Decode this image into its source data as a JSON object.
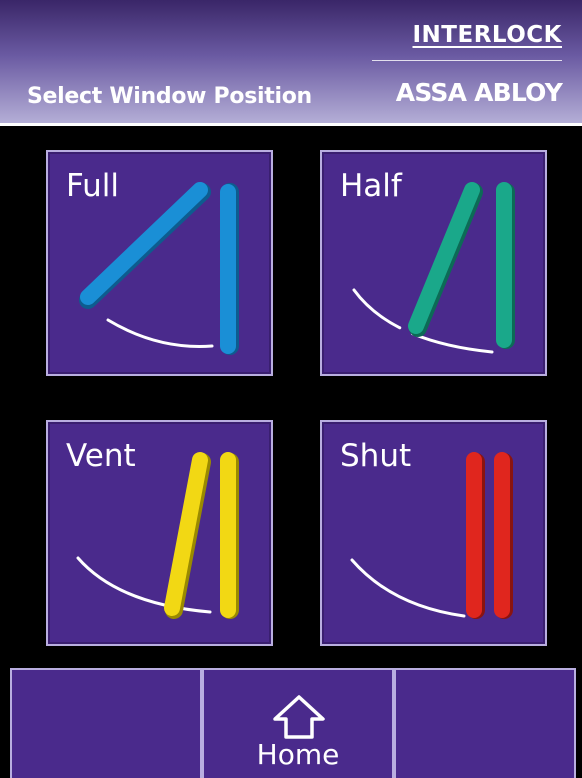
{
  "header": {
    "title": "Select Window Position",
    "brand_top": "INTERLOCK",
    "brand_bottom": "ASSA ABLOY"
  },
  "positions": [
    {
      "label": "Full",
      "color": "#1a8fd6"
    },
    {
      "label": "Half",
      "color": "#1aa88a"
    },
    {
      "label": "Vent",
      "color": "#f2d814"
    },
    {
      "label": "Shut",
      "color": "#e0261e"
    }
  ],
  "nav": {
    "home_label": "Home"
  },
  "colors": {
    "tile_background": "#4a2a8c",
    "tile_border": "#b9aee0",
    "screen_background": "#000000"
  }
}
